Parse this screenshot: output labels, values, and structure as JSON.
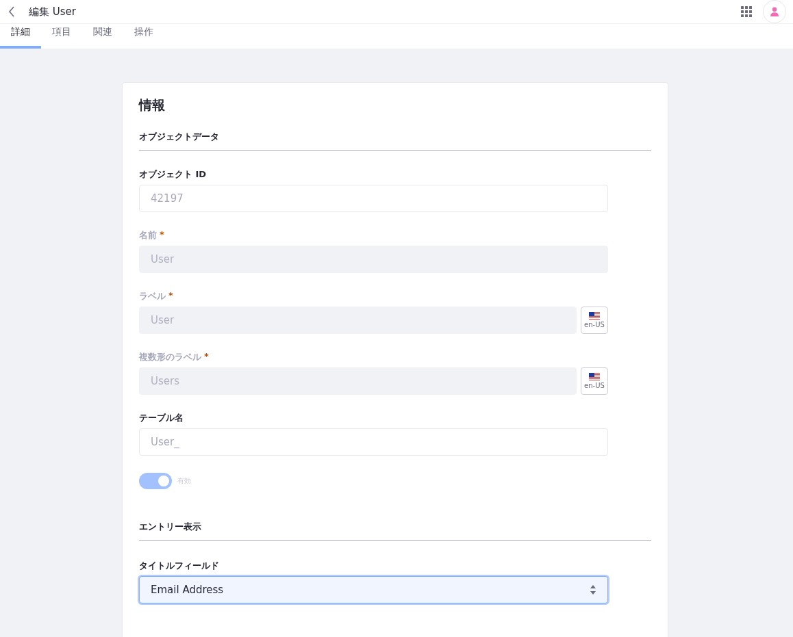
{
  "header": {
    "title": "編集 User"
  },
  "tabs": [
    {
      "label": "詳細",
      "selected": true
    },
    {
      "label": "項目",
      "selected": false
    },
    {
      "label": "関連",
      "selected": false
    },
    {
      "label": "操作",
      "selected": false
    }
  ],
  "card": {
    "heading": "情報",
    "sections": [
      {
        "title": "オブジェクトデータ",
        "fields": [
          {
            "kind": "text",
            "label": "オブジェクト ID",
            "value": "42197",
            "disabled": false
          },
          {
            "kind": "text",
            "label": "名前",
            "required_mark": "*",
            "value": "User",
            "disabled": true
          },
          {
            "kind": "text",
            "label": "ラベル",
            "required_mark": "*",
            "value": "User",
            "disabled": true,
            "locale": "en-US"
          },
          {
            "kind": "text",
            "label": "複数形のラベル",
            "required_mark": "*",
            "value": "Users",
            "disabled": true,
            "locale": "en-US"
          },
          {
            "kind": "text",
            "label": "テーブル名",
            "value": "User_",
            "disabled": false
          },
          {
            "kind": "toggle",
            "label": "有効",
            "on": true,
            "disabled": true
          }
        ]
      },
      {
        "title": "エントリー表示",
        "fields": [
          {
            "kind": "select",
            "label": "タイトルフィールド",
            "value": "Email Address",
            "focused": true
          }
        ]
      }
    ]
  }
}
